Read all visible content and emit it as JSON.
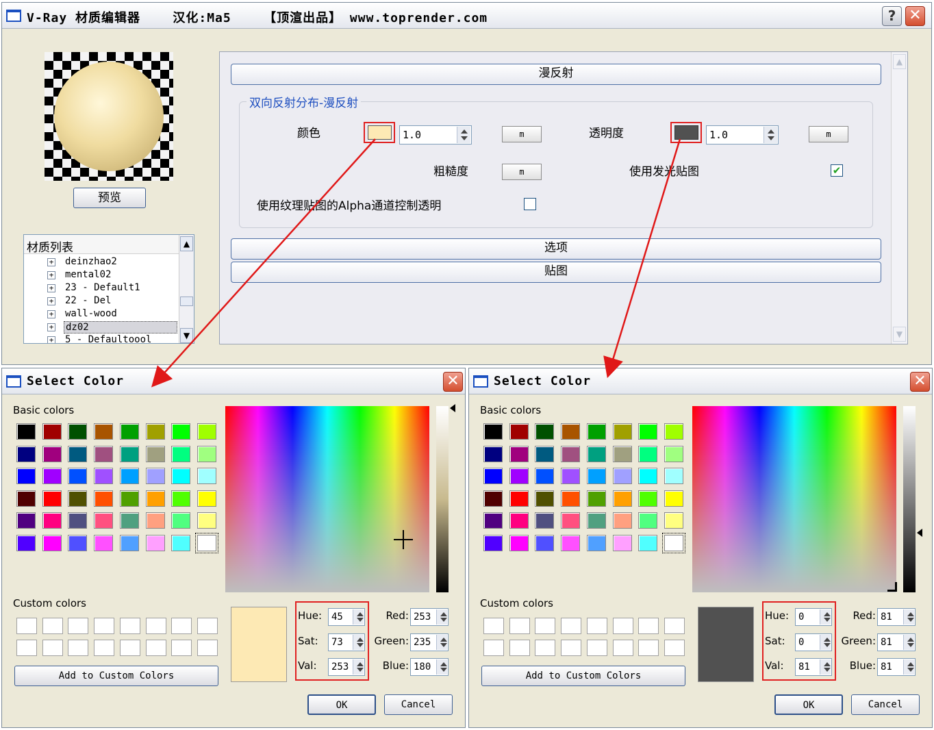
{
  "main_window": {
    "title": "V-Ray 材质编辑器    汉化:Ma5    【顶渲出品】 www.toprender.com",
    "help_icon": "?",
    "close_icon": "✕",
    "preview_button": "预览",
    "material_list": {
      "header": "材质列表",
      "items": [
        "deinzhao2",
        "mental02",
        "23 - Default1",
        "22 - Del",
        "wall-wood",
        "dz02",
        "5 - Defaultoool"
      ],
      "selected": "dz02"
    },
    "rollouts": {
      "diffuse": "漫反射",
      "options": "选项",
      "maps": "贴图"
    },
    "group_title": "双向反射分布-漫反射",
    "color_label": "颜色",
    "color_value": "1.0",
    "color_swatch": "#fde9b4",
    "transparency_label": "透明度",
    "transparency_value": "1.0",
    "transparency_swatch": "#515151",
    "map_button": "m",
    "roughness_label": "粗糙度",
    "use_glossy_map_label": "使用发光贴图",
    "use_glossy_map_checked": true,
    "use_alpha_label": "使用纹理贴图的Alpha通道控制透明",
    "use_alpha_checked": false
  },
  "dialogs": [
    {
      "title": "Select Color",
      "basic_colors_label": "Basic colors",
      "custom_colors_label": "Custom colors",
      "add_custom_label": "Add to Custom Colors",
      "hue_label": "Hue:",
      "sat_label": "Sat:",
      "val_label": "Val:",
      "red_label": "Red:",
      "green_label": "Green:",
      "blue_label": "Blue:",
      "hue": "45",
      "sat": "73",
      "val": "253",
      "red": "253",
      "green": "235",
      "blue": "180",
      "preview_color": "#fde9b4",
      "ok": "OK",
      "cancel": "Cancel"
    },
    {
      "title": "Select Color",
      "basic_colors_label": "Basic colors",
      "custom_colors_label": "Custom colors",
      "add_custom_label": "Add to Custom Colors",
      "hue_label": "Hue:",
      "sat_label": "Sat:",
      "val_label": "Val:",
      "red_label": "Red:",
      "green_label": "Green:",
      "blue_label": "Blue:",
      "hue": "0",
      "sat": "0",
      "val": "81",
      "red": "81",
      "green": "81",
      "blue": "81",
      "preview_color": "#515151",
      "ok": "OK",
      "cancel": "Cancel"
    }
  ],
  "basic_colors": [
    [
      "#000000",
      "#a00000",
      "#005000",
      "#a85400",
      "#00a000",
      "#a0a000",
      "#00ff00",
      "#a0ff00"
    ],
    [
      "#000080",
      "#a0007e",
      "#005a80",
      "#a05080",
      "#00a080",
      "#a0a080",
      "#00ff80",
      "#a0ff80"
    ],
    [
      "#0000ff",
      "#a000ff",
      "#0050ff",
      "#a050ff",
      "#00a0ff",
      "#a0a0ff",
      "#00ffff",
      "#a0ffff"
    ],
    [
      "#500000",
      "#ff0000",
      "#505000",
      "#ff5000",
      "#50a000",
      "#ffa000",
      "#50ff00",
      "#ffff00"
    ],
    [
      "#500080",
      "#ff0080",
      "#505080",
      "#ff5080",
      "#50a080",
      "#ffa080",
      "#50ff80",
      "#ffff80"
    ],
    [
      "#5000ff",
      "#ff00ff",
      "#5050ff",
      "#ff50ff",
      "#50a0ff",
      "#ffa0ff",
      "#50ffff",
      "#ffffff"
    ]
  ]
}
